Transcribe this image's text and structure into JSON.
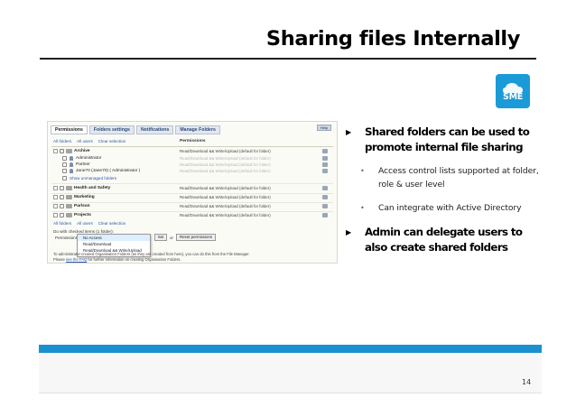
{
  "slide": {
    "title": "Sharing files Internally",
    "page_number": "14"
  },
  "logo": {
    "text": "SME",
    "color": "#1a9bd7"
  },
  "accent_color": "#1a91cf",
  "bullets": [
    {
      "level": 1,
      "text": "Shared folders can be used to promote internal file sharing"
    },
    {
      "level": 2,
      "text": "Access control lists supported at folder, role & user level"
    },
    {
      "level": 2,
      "text": "Can integrate with Active Directory"
    },
    {
      "level": 1,
      "text": "Admin can delegate users to also create shared folders"
    }
  ],
  "screenshot": {
    "tabs": [
      "Permissions",
      "Folders settings",
      "Notifications",
      "Manage Folders"
    ],
    "active_tab": 0,
    "help_label": "Help",
    "toolbar": [
      "All folders",
      "All users",
      "Clear selection"
    ],
    "permissions_header": "Permissions",
    "rows": [
      {
        "name": "Archive",
        "bold": true,
        "perm": "Read/Download && Write/Upload (default for folder)",
        "faint": false
      },
      {
        "name": "Administrator",
        "bold": false,
        "perm": "Read/Download && Write/Upload (default for folder)",
        "faint": true
      },
      {
        "name": "Partner",
        "bold": false,
        "perm": "Read/Download && Write/Upload (default for folder)",
        "faint": true
      },
      {
        "name": "Jane70 (Jane70) ( Administrator )",
        "bold": false,
        "perm": "Read/Download && Write/Upload (default for folder)",
        "faint": true
      },
      {
        "name": "Show unmanaged folders",
        "bold": false,
        "perm": "",
        "faint": false
      },
      {
        "name": "Health and Safety",
        "bold": true,
        "perm": "Read/Download && Write/Upload (default for folder)",
        "faint": false
      },
      {
        "name": "Marketing",
        "bold": true,
        "perm": "Read/Download && Write/Upload (default for folder)",
        "faint": false
      },
      {
        "name": "Parlson",
        "bold": true,
        "perm": "Read/Download && Write/Upload (default for folder)",
        "faint": false
      },
      {
        "name": "Projects",
        "bold": true,
        "perm": "Read/Download && Write/Upload (default for folder)",
        "faint": false
      }
    ],
    "bottom_toolbar": [
      "All folders",
      "All users",
      "Clear selection"
    ],
    "selection_label": "Do with checked items (1 folder):",
    "permission_label": "Permissions",
    "dropdown_options": [
      "No Access",
      "Read/Download",
      "Read/Download && Write/Upload"
    ],
    "dropdown_selected": 0,
    "set_button": "Set",
    "or_text": "or",
    "reset_button": "Reset permissions",
    "note": "To administrator-created Organisation Folders (as they are created from here), you can do this from the File Manager.",
    "note2_pre": "Please ",
    "note2_link": "see the FAQ",
    "note2_post": " for further information on creating Organisation Folders."
  }
}
